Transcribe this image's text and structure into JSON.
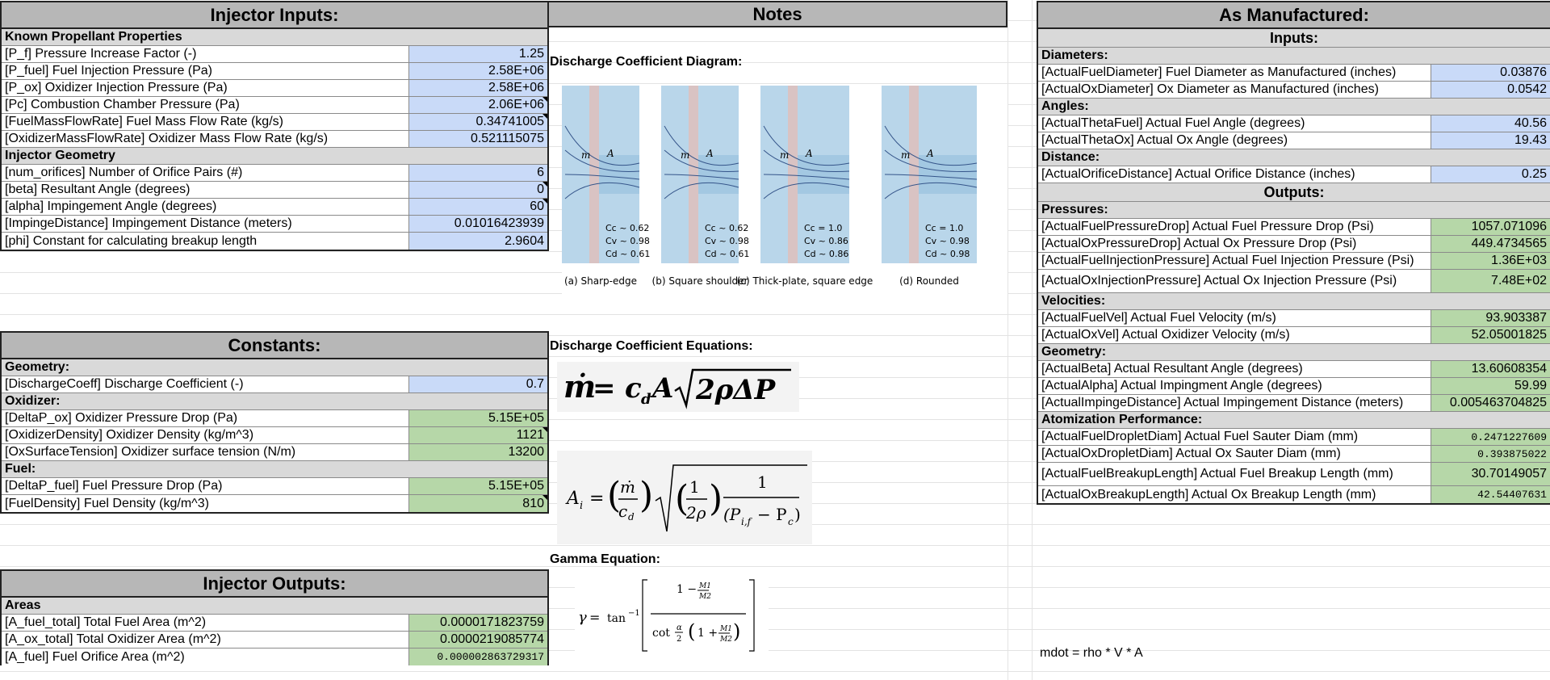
{
  "injector_inputs": {
    "title": "Injector Inputs:",
    "sections": [
      {
        "header": "Known Propellant Properties",
        "rows": [
          {
            "label": "[P_f] Pressure Increase Factor (-)",
            "value": "1.25",
            "color": "blue"
          },
          {
            "label": "[P_fuel] Fuel Injection Pressure (Pa)",
            "value": "2.58E+06",
            "color": "blue"
          },
          {
            "label": "[P_ox] Oxidizer Injection Pressure (Pa)",
            "value": "2.58E+06",
            "color": "blue"
          },
          {
            "label": "[Pc] Combustion Chamber Pressure (Pa)",
            "value": "2.06E+06",
            "color": "blue",
            "flag": true
          },
          {
            "label": "[FuelMassFlowRate] Fuel Mass Flow Rate (kg/s)",
            "value": "0.34741005",
            "color": "blue",
            "flag": true
          },
          {
            "label": "[OxidizerMassFlowRate] Oxidizer Mass Flow Rate (kg/s)",
            "value": "0.521115075",
            "color": "blue"
          }
        ]
      },
      {
        "header": "Injector Geometry",
        "rows": [
          {
            "label": "[num_orifices] Number of Orifice Pairs (#)",
            "value": "6",
            "color": "blue"
          },
          {
            "label": "[beta] Resultant Angle (degrees)",
            "value": "0",
            "color": "blue",
            "flag": true
          },
          {
            "label": "[alpha] Impingement Angle (degrees)",
            "value": "60",
            "color": "blue",
            "flag": true
          },
          {
            "label": "[ImpingeDistance] Impingement Distance (meters)",
            "value": "0.01016423939",
            "color": "blue"
          },
          {
            "label": "[phi] Constant for calculating breakup length",
            "value": "2.9604",
            "color": "blue"
          }
        ]
      }
    ]
  },
  "constants": {
    "title": "Constants:",
    "sections": [
      {
        "header": "Geometry:",
        "rows": [
          {
            "label": "[DischargeCoeff] Discharge Coefficient (-)",
            "value": "0.7",
            "color": "blue"
          }
        ]
      },
      {
        "header": "Oxidizer:",
        "rows": [
          {
            "label": "[DeltaP_ox] Oxidizer Pressure Drop (Pa)",
            "value": "5.15E+05",
            "color": "green"
          },
          {
            "label": "[OxidizerDensity] Oxidizer Density (kg/m^3)",
            "value": "1121",
            "color": "green",
            "flag": true
          },
          {
            "label": "[OxSurfaceTension] Oxidizer surface tension (N/m)",
            "value": "13200",
            "color": "green"
          }
        ]
      },
      {
        "header": "Fuel:",
        "rows": [
          {
            "label": "[DeltaP_fuel] Fuel Pressure Drop (Pa)",
            "value": "5.15E+05",
            "color": "green"
          },
          {
            "label": "[FuelDensity] Fuel Density (kg/m^3)",
            "value": "810",
            "color": "green",
            "flag": true
          }
        ]
      }
    ]
  },
  "injector_outputs": {
    "title": "Injector Outputs:",
    "sections": [
      {
        "header": "Areas",
        "rows": [
          {
            "label": "[A_fuel_total] Total Fuel Area (m^2)",
            "value": "0.0000171823759",
            "color": "green"
          },
          {
            "label": "[A_ox_total] Total Oxidizer Area (m^2)",
            "value": "0.0000219085774",
            "color": "green"
          },
          {
            "label": "[A_fuel] Fuel Orifice Area (m^2)",
            "value": "0.000002863729317",
            "color": "green",
            "mono": true
          }
        ]
      }
    ]
  },
  "notes": {
    "title": "Notes",
    "discharge_diagram_label": "Discharge Coefficient Diagram:",
    "discharge_equations_label": "Discharge Coefficient Equations:",
    "gamma_label": "Gamma Equation:",
    "diagram_panels": [
      {
        "caption": "(a) Sharp-edge",
        "coeffs": [
          "Cc ~ 0.62",
          "Cv ~ 0.98",
          "Cd ~ 0.61"
        ]
      },
      {
        "caption": "(b) Square shoulder",
        "coeffs": [
          "Cc ~ 0.62",
          "Cv ~ 0.98",
          "Cd ~ 0.61"
        ]
      },
      {
        "caption": "(c) Thick-plate, square edge",
        "coeffs": [
          "Cc = 1.0",
          "Cv ~ 0.86",
          "Cd ~ 0.86"
        ]
      },
      {
        "caption": "(d) Rounded",
        "coeffs": [
          "Cc = 1.0",
          "Cv ~ 0.98",
          "Cd ~ 0.98"
        ]
      }
    ],
    "equation1": "ṁ = c_d A √(2ρΔP)",
    "equation2": "A_i = (ṁ / c_d) √(1/2ρ) · 1/(P_i,f − P_c)",
    "gamma_equation": "γ = tan⁻¹[(1 − M1/M2) / (cot(α/2)(1 + M1/M2))]"
  },
  "as_manufactured": {
    "title": "As Manufactured:",
    "inputs_title": "Inputs:",
    "outputs_title": "Outputs:",
    "input_sections": [
      {
        "header": "Diameters:",
        "rows": [
          {
            "label": "[ActualFuelDiameter] Fuel Diameter as Manufactured (inches)",
            "value": "0.03876",
            "color": "blue"
          },
          {
            "label": "[ActualOxDiameter] Ox Diameter as Manufactured (inches)",
            "value": "0.0542",
            "color": "blue"
          }
        ]
      },
      {
        "header": "Angles:",
        "rows": [
          {
            "label": "[ActualThetaFuel] Actual Fuel Angle (degrees)",
            "value": "40.56",
            "color": "blue"
          },
          {
            "label": "[ActualThetaOx] Actual Ox Angle (degrees)",
            "value": "19.43",
            "color": "blue"
          }
        ]
      },
      {
        "header": "Distance:",
        "rows": [
          {
            "label": "[ActualOrificeDistance] Actual Orifice Distance (inches)",
            "value": "0.25",
            "color": "blue"
          }
        ]
      }
    ],
    "output_sections": [
      {
        "header": "Pressures:",
        "rows": [
          {
            "label": "[ActualFuelPressureDrop] Actual Fuel Pressure Drop (Psi)",
            "value": "1057.071096",
            "color": "green"
          },
          {
            "label": "[ActualOxPressureDrop] Actual Ox Pressure Drop (Psi)",
            "value": "449.4734565",
            "color": "green"
          },
          {
            "label": "[ActualFuelInjectionPressure] Actual Fuel Injection Pressure (Psi)",
            "value": "1.36E+03",
            "color": "green"
          },
          {
            "label": "[ActualOxInjectionPressure] Actual Ox Injection Pressure (Psi)",
            "value": "7.48E+02",
            "color": "green",
            "tall": true
          }
        ]
      },
      {
        "header": "Velocities:",
        "rows": [
          {
            "label": "[ActualFuelVel] Actual Fuel Velocity (m/s)",
            "value": "93.903387",
            "color": "green"
          },
          {
            "label": "[ActualOxVel] Actual Oxidizer Velocity (m/s)",
            "value": "52.05001825",
            "color": "green"
          }
        ]
      },
      {
        "header": "Geometry:",
        "rows": [
          {
            "label": "[ActualBeta] Actual Resultant Angle (degrees)",
            "value": "13.60608354",
            "color": "green"
          },
          {
            "label": "[ActualAlpha] Actual Impingment Angle (degrees)",
            "value": "59.99",
            "color": "green"
          },
          {
            "label": "[ActualImpingeDistance] Actual Impingement Distance (meters)",
            "value": "0.005463704825",
            "color": "green"
          }
        ]
      },
      {
        "header": "Atomization Performance:",
        "rows": [
          {
            "label": "[ActualFuelDropletDiam] Actual Fuel Sauter Diam (mm)",
            "value": "0.2471227609",
            "color": "green",
            "mono": true
          },
          {
            "label": "[ActualOxDropletDiam] Actual Ox Sauter Diam (mm)",
            "value": "0.393875022",
            "color": "green",
            "mono": true
          },
          {
            "label": "[ActualFuelBreakupLength] Actual Fuel Breakup Length (mm)",
            "value": "30.70149057",
            "color": "green",
            "tall": true
          },
          {
            "label": "[ActualOxBreakupLength] Actual Ox Breakup Length (mm)",
            "value": "42.54407631",
            "color": "green",
            "mono": true
          }
        ]
      }
    ],
    "footnote": "mdot = rho * V * A"
  },
  "colors": {
    "input_blue": "#c9daf8",
    "output_green": "#b6d7a8",
    "header_gray": "#b7b7b7",
    "section_gray": "#d9d9d9"
  }
}
